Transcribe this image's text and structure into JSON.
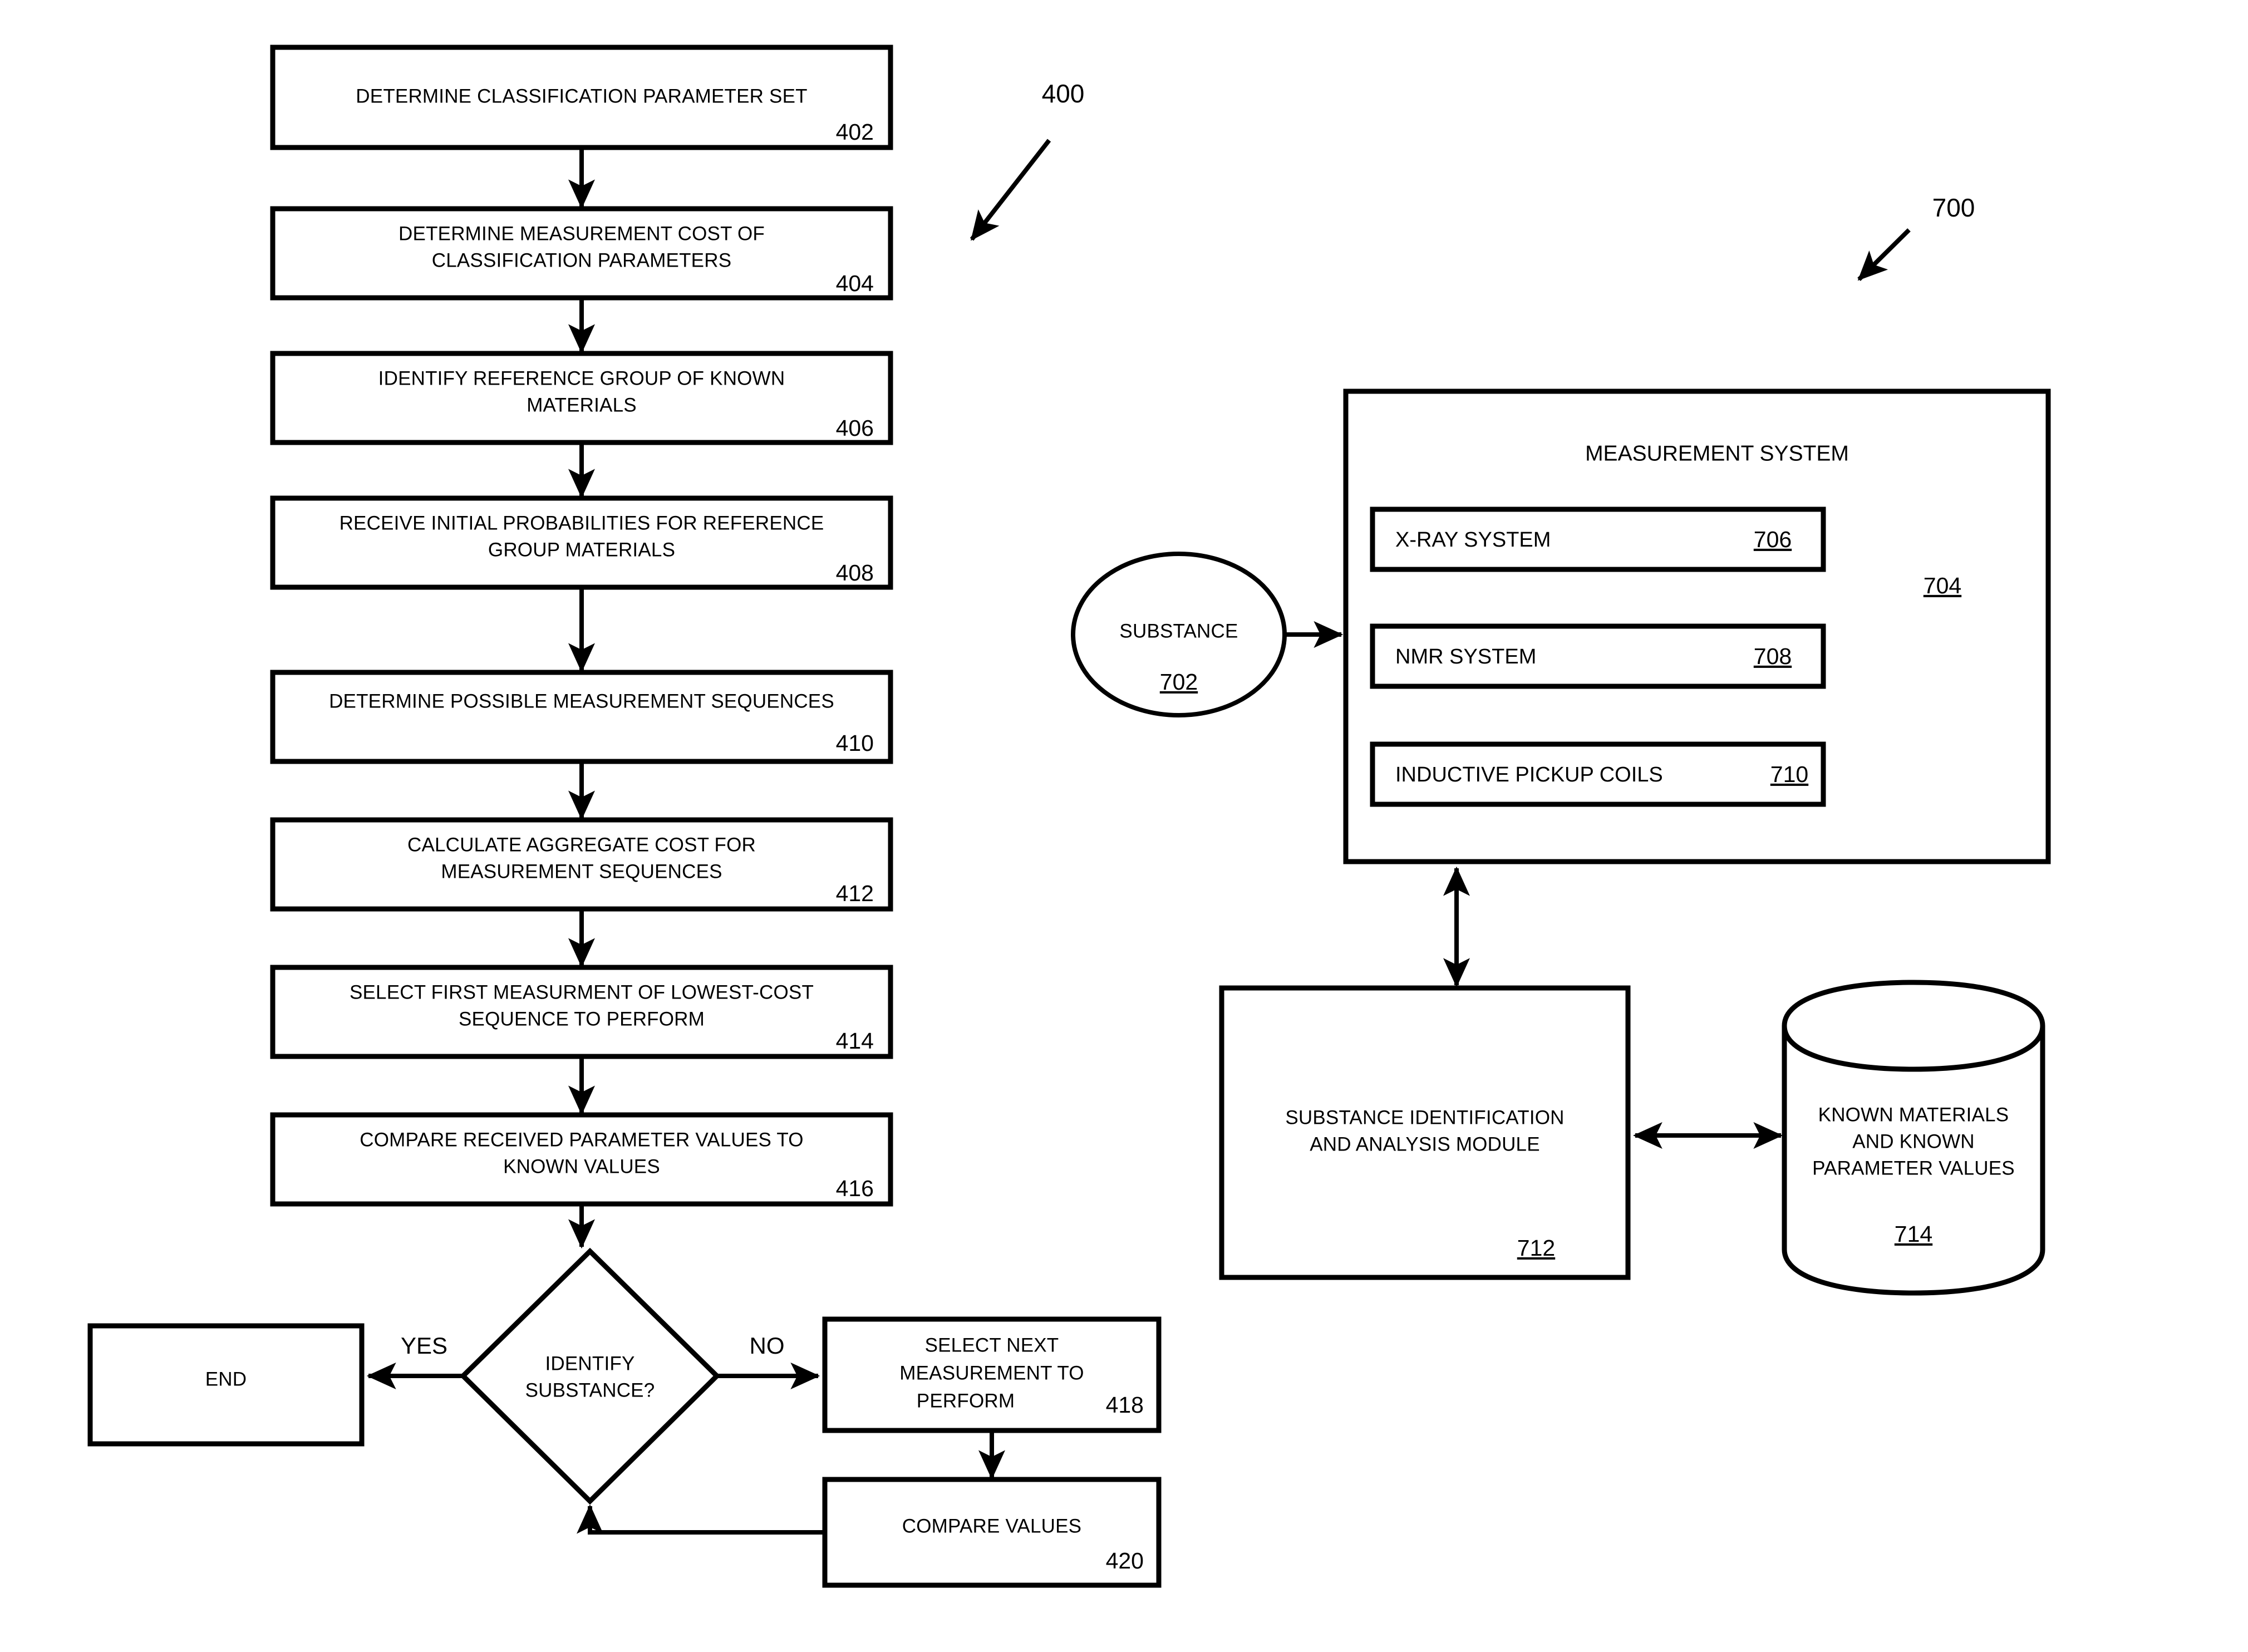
{
  "figure": {
    "left_label": "400",
    "right_label": "700"
  },
  "flowchart": {
    "steps": [
      {
        "id": "402",
        "lines": [
          "DETERMINE CLASSIFICATION PARAMETER SET"
        ]
      },
      {
        "id": "404",
        "lines": [
          "DETERMINE MEASUREMENT COST OF",
          "CLASSIFICATION PARAMETERS"
        ]
      },
      {
        "id": "406",
        "lines": [
          "IDENTIFY REFERENCE GROUP OF KNOWN",
          "MATERIALS"
        ]
      },
      {
        "id": "408",
        "lines": [
          "RECEIVE INITIAL PROBABILITIES FOR REFERENCE",
          "GROUP MATERIALS"
        ]
      },
      {
        "id": "410",
        "lines": [
          "DETERMINE POSSIBLE MEASUREMENT SEQUENCES"
        ]
      },
      {
        "id": "412",
        "lines": [
          "CALCULATE AGGREGATE COST FOR",
          "MEASUREMENT SEQUENCES"
        ]
      },
      {
        "id": "414",
        "lines": [
          "SELECT FIRST MEASURMENT OF LOWEST-COST",
          "SEQUENCE TO PERFORM"
        ]
      },
      {
        "id": "416",
        "lines": [
          "COMPARE RECEIVED PARAMETER VALUES TO",
          "KNOWN VALUES"
        ]
      }
    ],
    "decision": {
      "lines": [
        "IDENTIFY",
        "SUBSTANCE?"
      ],
      "yes_label": "YES",
      "no_label": "NO"
    },
    "end_box": {
      "label": "END"
    },
    "loop_steps": [
      {
        "id": "418",
        "lines": [
          "SELECT NEXT",
          "MEASUREMENT TO",
          "PERFORM"
        ]
      },
      {
        "id": "420",
        "lines": [
          "COMPARE VALUES"
        ]
      }
    ]
  },
  "system": {
    "substance": {
      "label": "SUBSTANCE",
      "id": "702"
    },
    "measurement_system": {
      "title": "MEASUREMENT SYSTEM",
      "id": "704",
      "subsystems": [
        {
          "label": "X-RAY SYSTEM",
          "id": "706"
        },
        {
          "label": "NMR SYSTEM",
          "id": "708"
        },
        {
          "label": "INDUCTIVE PICKUP COILS",
          "id": "710"
        }
      ]
    },
    "analysis_module": {
      "lines": [
        "SUBSTANCE IDENTIFICATION",
        "AND ANALYSIS MODULE"
      ],
      "id": "712"
    },
    "database": {
      "lines": [
        "KNOWN MATERIALS",
        "AND KNOWN",
        "PARAMETER VALUES"
      ],
      "id": "714"
    }
  }
}
